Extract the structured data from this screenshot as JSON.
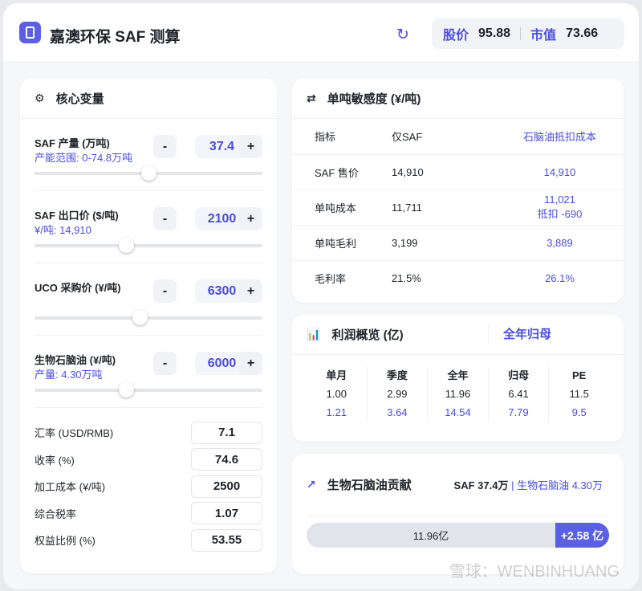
{
  "header": {
    "title": "嘉澳环保 SAF 测算",
    "price_label": "股价",
    "price": "95.88",
    "cap_label": "市值",
    "cap": "73.66"
  },
  "vars": {
    "title": "核心变量",
    "items": [
      {
        "label": "SAF 产量 (万吨)",
        "sub": "产能范围: 0-74.8万吨",
        "value": "37.4",
        "minus": "-",
        "plus": "+",
        "slider": 0.5
      },
      {
        "label": "SAF 出口价 ($/吨)",
        "sub": "¥/吨: 14,910",
        "value": "2100",
        "minus": "-",
        "plus": "+",
        "slider": 0.4
      },
      {
        "label": "UCO 采购价 (¥/吨)",
        "sub": "",
        "value": "6300",
        "minus": "-",
        "plus": "+",
        "slider": 0.46
      },
      {
        "label": "生物石脑油 (¥/吨)",
        "sub": "产量: 4.30万吨",
        "value": "6000",
        "minus": "-",
        "plus": "+",
        "slider": 0.4
      }
    ],
    "params": [
      {
        "label": "汇率 (USD/RMB)",
        "value": "7.1"
      },
      {
        "label": "收率 (%)",
        "value": "74.6"
      },
      {
        "label": "加工成本 (¥/吨)",
        "value": "2500"
      },
      {
        "label": "综合税率",
        "value": "1.07"
      },
      {
        "label": "权益比例 (%)",
        "value": "53.55"
      }
    ]
  },
  "sens": {
    "title": "单吨敏感度 (¥/吨)",
    "headers": [
      "指标",
      "仅SAF",
      "石脑油抵扣成本"
    ],
    "rows": [
      [
        "SAF 售价",
        "14,910",
        "14,910",
        ""
      ],
      [
        "单吨成本",
        "11,711",
        "11,021",
        "抵扣 -690"
      ],
      [
        "单吨毛利",
        "3,199",
        "3,889",
        ""
      ],
      [
        "毛利率",
        "21.5%",
        "26.1%",
        ""
      ]
    ]
  },
  "profit": {
    "title": "利润概览 (亿)",
    "toggle": "全年归母",
    "cols": [
      {
        "h": "单月",
        "a": "1.00",
        "b": "1.21"
      },
      {
        "h": "季度",
        "a": "2.99",
        "b": "3.64"
      },
      {
        "h": "全年",
        "a": "11.96",
        "b": "14.54"
      },
      {
        "h": "归母",
        "a": "6.41",
        "b": "7.79"
      },
      {
        "h": "PE",
        "a": "11.5",
        "b": "9.5"
      }
    ]
  },
  "contrib": {
    "title": "生物石脑油贡献",
    "saf": "SAF 37.4万",
    "naphtha": "| 生物石脑油 4.30万",
    "base": "11.96亿",
    "add": "+2.58 亿"
  },
  "watermark": "雪球：WENBINHUANG"
}
